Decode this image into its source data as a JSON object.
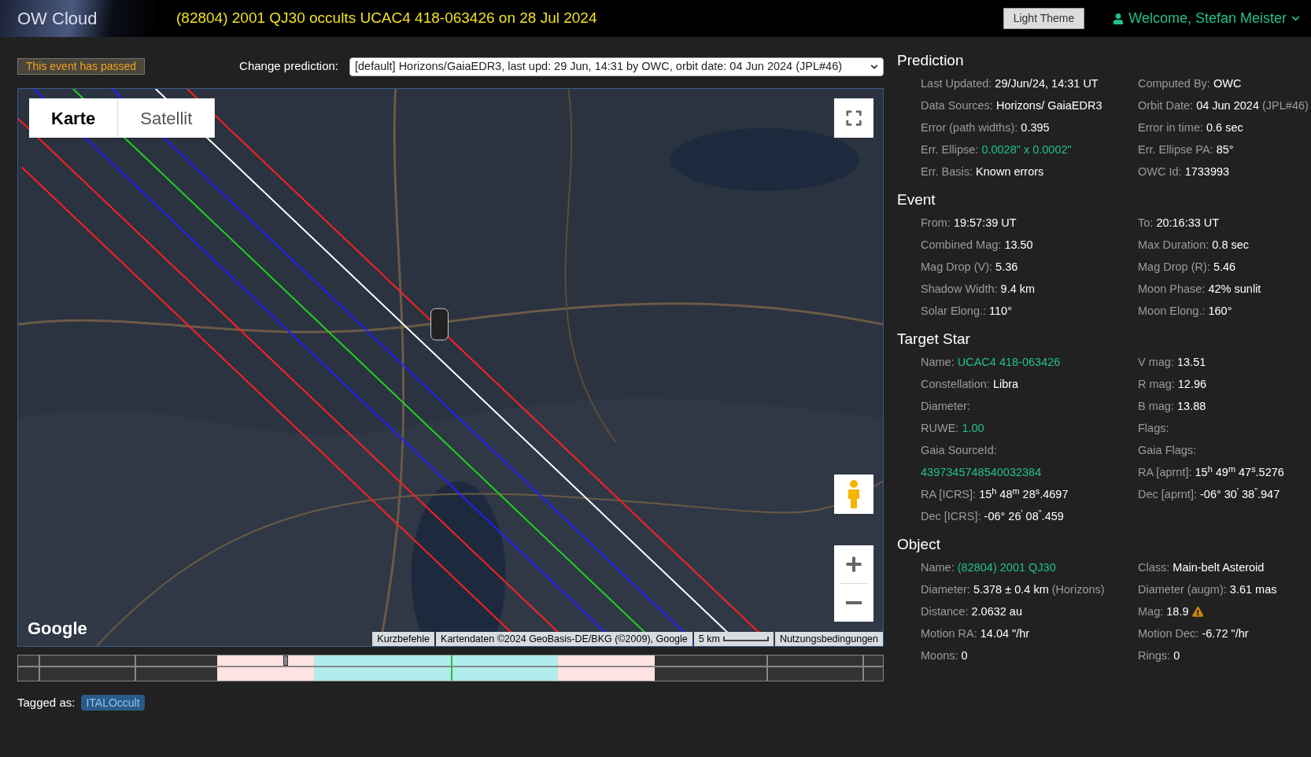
{
  "header": {
    "logo": "OW Cloud",
    "title": "(82804) 2001 QJ30 occults UCAC4 418-063426 on 28 Jul 2024",
    "theme_button": "Light Theme",
    "user": "Welcome, Stefan Meister"
  },
  "status_badge": "This event has passed",
  "prediction_select": {
    "label": "Change prediction:",
    "value": "[default] Horizons/GaiaEDR3, last upd: 29 Jun, 14:31 by OWC, orbit date: 04 Jun 2024 (JPL#46)"
  },
  "map": {
    "map_types": [
      {
        "label": "Karte",
        "selected": true
      },
      {
        "label": "Satellit",
        "selected": false
      }
    ],
    "google": "Google",
    "attribution": [
      "Kurzbefehle",
      "Kartendaten ©2024 GeoBasis-DE/BKG (©2009), Google"
    ],
    "scale": "5 km",
    "terms": "Nutzungsbedingungen"
  },
  "tags": {
    "label": "Tagged as:",
    "items": [
      "ITALOccult"
    ]
  },
  "sections": [
    {
      "title": "Prediction",
      "left": [
        {
          "label": "Last Updated:",
          "value": "29/Jun/24, 14:31 UT"
        },
        {
          "label": "Data Sources:",
          "value": "Horizons/ GaiaEDR3"
        },
        {
          "label": "Error (path widths):",
          "value": "0.395"
        },
        {
          "label": "Err. Ellipse:",
          "value": "0.0028\" x 0.0002\"",
          "link": true
        },
        {
          "label": "Err. Basis:",
          "value": "Known errors"
        }
      ],
      "right": [
        {
          "label": "Computed By:",
          "value": "OWC"
        },
        {
          "label": "Orbit Date:",
          "value": "04 Jun 2024",
          "note": "(JPL#46)"
        },
        {
          "label": "Error in time:",
          "value": "0.6 sec"
        },
        {
          "label": "Err. Ellipse PA:",
          "value": "85°"
        },
        {
          "label": "OWC Id:",
          "value": "1733993"
        }
      ]
    },
    {
      "title": "Event",
      "left": [
        {
          "label": "From:",
          "value": "19:57:39 UT"
        },
        {
          "label": "Combined Mag:",
          "value": "13.50"
        },
        {
          "label": "Mag Drop (V):",
          "value": "5.36"
        },
        {
          "label": "Shadow Width:",
          "value": "9.4 km"
        },
        {
          "label": "Solar Elong.:",
          "value": "110°"
        }
      ],
      "right": [
        {
          "label": "To:",
          "value": "20:16:33 UT"
        },
        {
          "label": "Max Duration:",
          "value": "0.8 sec"
        },
        {
          "label": "Mag Drop (R):",
          "value": "5.46"
        },
        {
          "label": "Moon Phase:",
          "value": "42% sunlit"
        },
        {
          "label": "Moon Elong.:",
          "value": "160°"
        }
      ]
    },
    {
      "title": "Target Star",
      "left": [
        {
          "label": "Name:",
          "value": "UCAC4 418-063426",
          "link": true
        },
        {
          "label": "Constellation:",
          "value": "Libra"
        },
        {
          "label": "Diameter:"
        },
        {
          "label": "RUWE:",
          "value": "1.00",
          "link": true
        },
        {
          "label": "Gaia SourceId:",
          "value": "4397345748540032384",
          "link": true
        },
        {
          "label": "RA [ICRS]:",
          "value": "15$^{h}$ 48$^{m}$ 28$^{s}$.4697"
        },
        {
          "label": "Dec [ICRS]:",
          "value": "-06° 26$^{'}$ 08$^{\"}$.459"
        }
      ],
      "right": [
        {
          "label": "V mag:",
          "value": "13.51"
        },
        {
          "label": "R mag:",
          "value": "12.96"
        },
        {
          "label": "B mag:",
          "value": "13.88"
        },
        {
          "label": "Flags:"
        },
        {
          "label": "Gaia Flags:"
        },
        {
          "label": "RA [aprnt]:",
          "value": "15$^{h}$ 49$^{m}$ 47$^{s}$.5276"
        },
        {
          "label": "Dec [aprnt]:",
          "value": "-06° 30$^{'}$ 38$^{\"}$.947"
        }
      ]
    },
    {
      "title": "Object",
      "left": [
        {
          "label": "Name:",
          "value": "(82804) 2001 QJ30",
          "link": true
        },
        {
          "label": "Diameter:",
          "value": "5.378 ± 0.4 km",
          "note": "(Horizons)"
        },
        {
          "label": "Distance:",
          "value": "2.0632 au"
        },
        {
          "label": "Motion RA:",
          "value": "14.04 \"/hr"
        },
        {
          "label": "Moons:",
          "value": "0"
        }
      ],
      "right": [
        {
          "label": "Class:",
          "value": "Main-belt Asteroid"
        },
        {
          "label": "Diameter (augm):",
          "value": "3.61 mas"
        },
        {
          "label": "Mag:",
          "value": "18.9",
          "warning": true
        },
        {
          "label": "Motion Dec:",
          "value": "-6.72 \"/hr"
        },
        {
          "label": "Rings:",
          "value": "0"
        }
      ]
    }
  ]
}
